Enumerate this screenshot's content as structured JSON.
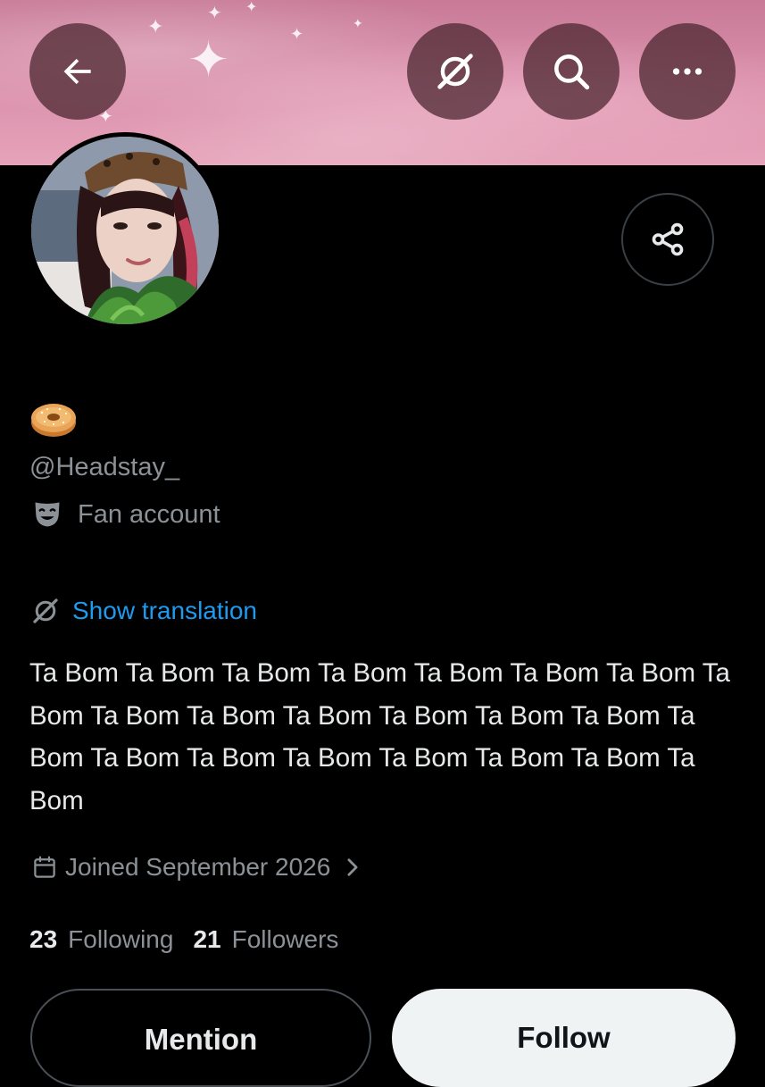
{
  "profile": {
    "display_name_emoji": "🥯",
    "handle": "@Headstay_",
    "category": "Fan account",
    "translate_label": "Show translation",
    "bio": "Ta Bom Ta Bom Ta Bom Ta Bom Ta Bom Ta Bom Ta Bom Ta Bom Ta Bom Ta Bom Ta Bom Ta Bom Ta Bom Ta Bom Ta Bom Ta Bom Ta Bom Ta Bom Ta Bom Ta Bom Ta Bom Ta Bom",
    "joined": "Joined September 2026",
    "following_count": "23",
    "following_label": "Following",
    "followers_count": "21",
    "followers_label": "Followers"
  },
  "actions": {
    "mention_label": "Mention",
    "follow_label": "Follow"
  },
  "icons": {
    "back": "back-arrow-icon",
    "translate_top": "translate-icon",
    "search": "search-icon",
    "more": "more-icon",
    "share": "share-icon",
    "category": "theater-mask-icon",
    "translate_inline": "translate-icon",
    "calendar": "calendar-icon",
    "chevron": "chevron-right-icon"
  },
  "colors": {
    "background": "#000000",
    "link": "#1d9bf0",
    "secondary_text": "#8b9196",
    "primary_text": "#e7e9ea",
    "follow_button": "#eff3f4"
  }
}
